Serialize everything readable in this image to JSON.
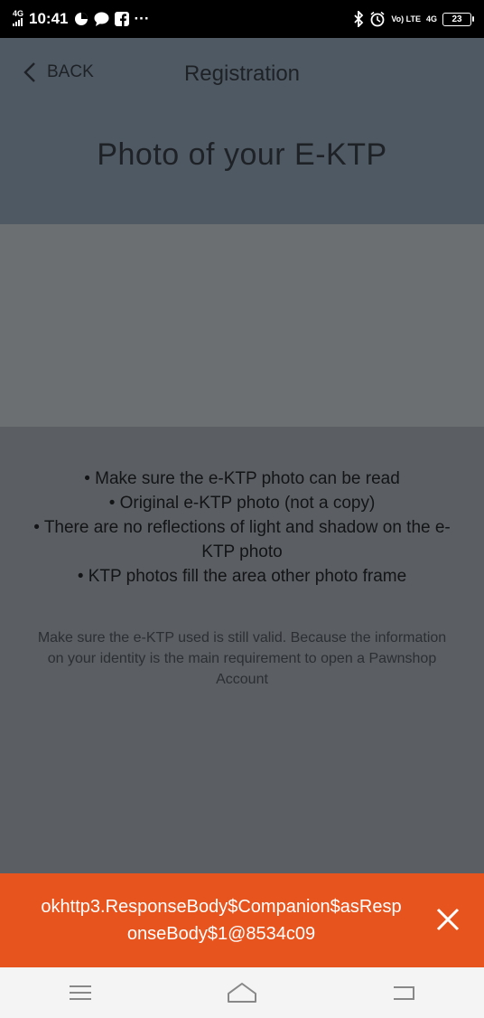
{
  "status_bar": {
    "network": "4G",
    "time": "10:41",
    "more": "···",
    "battery": "23",
    "volte": "Vo) LTE",
    "network_right": "4G"
  },
  "header": {
    "back_label": "BACK",
    "title": "Registration",
    "page_heading": "Photo of your E-KTP"
  },
  "requirements": [
    "• Make sure the e-KTP photo can be read",
    "• Original e-KTP photo (not a copy)",
    "• There are no reflections of light and shadow on the e-KTP photo",
    "• KTP photos fill the area other photo frame"
  ],
  "note": "Make sure the e-KTP used is still valid. Because the information on your identity is the main requirement to open a Pawnshop Account",
  "toast": {
    "message": "okhttp3.ResponseBody$Companion$asResponseBody$1@8534c09"
  },
  "colors": {
    "toast_bg": "#e8541e",
    "header_bg": "#4f5963",
    "overlay_bg": "#5b5e62"
  }
}
